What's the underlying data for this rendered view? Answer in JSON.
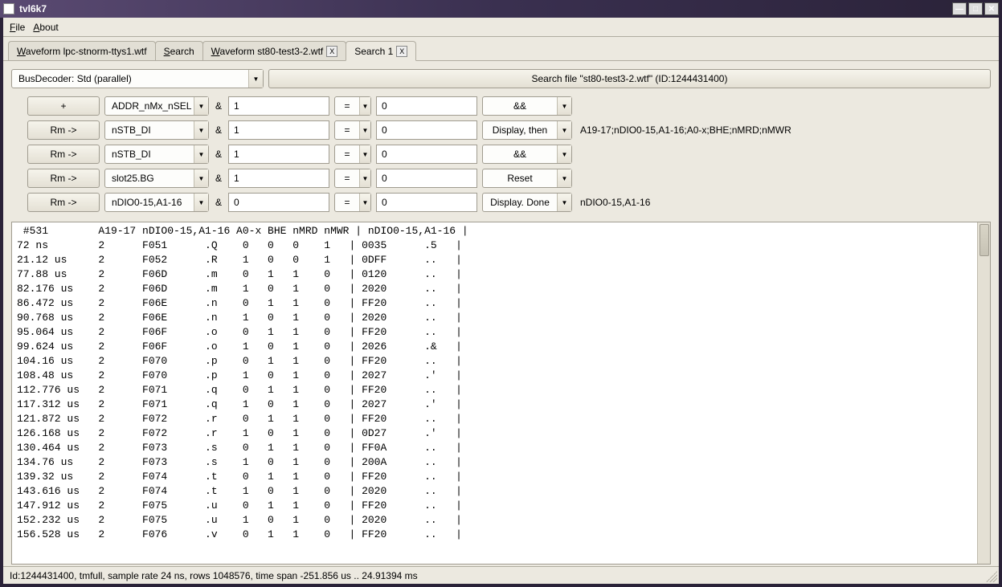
{
  "window": {
    "title": "tvl6k7"
  },
  "menu": {
    "file": "File",
    "about": "About"
  },
  "tabs": {
    "items": [
      {
        "label": "Waveform lpc-stnorm-ttys1.wtf",
        "closable": false
      },
      {
        "label": "Search",
        "closable": false
      },
      {
        "label": "Waveform st80-test3-2.wtf",
        "closable": true
      },
      {
        "label": "Search 1",
        "closable": true
      }
    ],
    "activeIndex": 3
  },
  "decoder": {
    "label": "BusDecoder: Std (parallel)",
    "search_button": "Search file \"st80-test3-2.wtf\" (ID:1244431400)"
  },
  "rules": [
    {
      "btn": "+",
      "signal": "ADDR_nMx_nSEL",
      "val1": "1",
      "op": "=",
      "val2": "0",
      "action": "&&",
      "note": ""
    },
    {
      "btn": "Rm ->",
      "signal": "nSTB_DI",
      "val1": "1",
      "op": "=",
      "val2": "0",
      "action": "Display, then",
      "note": "A19-17;nDIO0-15,A1-16;A0-x;BHE;nMRD;nMWR"
    },
    {
      "btn": "Rm ->",
      "signal": "nSTB_DI",
      "val1": "1",
      "op": "=",
      "val2": "0",
      "action": "&&",
      "note": ""
    },
    {
      "btn": "Rm ->",
      "signal": "slot25.BG",
      "val1": "1",
      "op": "=",
      "val2": "0",
      "action": "Reset",
      "note": ""
    },
    {
      "btn": "Rm ->",
      "signal": "nDIO0-15,A1-16",
      "val1": "0",
      "op": "=",
      "val2": "0",
      "action": "Display. Done",
      "note": "nDIO0-15,A1-16"
    }
  ],
  "results": {
    "header": " #531        A19-17 nDIO0-15,A1-16 A0-x BHE nMRD nMWR | nDIO0-15,A1-16 |",
    "rows": [
      "72 ns        2      F051      .Q    0   0   0    1   | 0035      .5   |",
      "21.12 us     2      F052      .R    1   0   0    1   | 0DFF      ..   |",
      "77.88 us     2      F06D      .m    0   1   1    0   | 0120      ..   |",
      "82.176 us    2      F06D      .m    1   0   1    0   | 2020      ..   |",
      "86.472 us    2      F06E      .n    0   1   1    0   | FF20      ..   |",
      "90.768 us    2      F06E      .n    1   0   1    0   | 2020      ..   |",
      "95.064 us    2      F06F      .o    0   1   1    0   | FF20      ..   |",
      "99.624 us    2      F06F      .o    1   0   1    0   | 2026      .&   |",
      "104.16 us    2      F070      .p    0   1   1    0   | FF20      ..   |",
      "108.48 us    2      F070      .p    1   0   1    0   | 2027      .'   |",
      "112.776 us   2      F071      .q    0   1   1    0   | FF20      ..   |",
      "117.312 us   2      F071      .q    1   0   1    0   | 2027      .'   |",
      "121.872 us   2      F072      .r    0   1   1    0   | FF20      ..   |",
      "126.168 us   2      F072      .r    1   0   1    0   | 0D27      .'   |",
      "130.464 us   2      F073      .s    0   1   1    0   | FF0A      ..   |",
      "134.76 us    2      F073      .s    1   0   1    0   | 200A      ..   |",
      "139.32 us    2      F074      .t    0   1   1    0   | FF20      ..   |",
      "143.616 us   2      F074      .t    1   0   1    0   | 2020      ..   |",
      "147.912 us   2      F075      .u    0   1   1    0   | FF20      ..   |",
      "152.232 us   2      F075      .u    1   0   1    0   | 2020      ..   |",
      "156.528 us   2      F076      .v    0   1   1    0   | FF20      ..   |"
    ]
  },
  "status": "Id:1244431400, tmfull, sample rate 24 ns, rows 1048576, time span -251.856 us .. 24.91394 ms"
}
